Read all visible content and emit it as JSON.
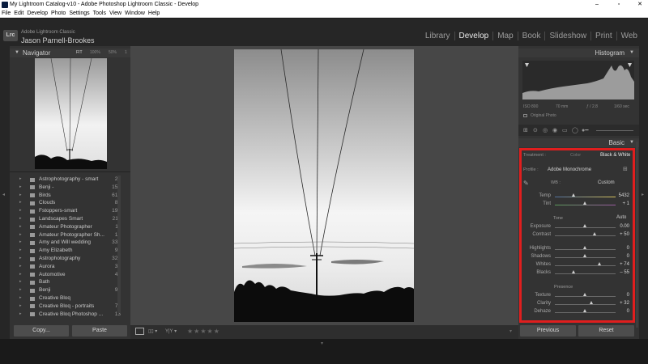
{
  "window": {
    "title": "My Lightroom Catalog-v10 - Adobe Photoshop Lightroom Classic - Develop",
    "minimize": "–",
    "maximize": "▫",
    "close": "✕"
  },
  "menu": [
    "File",
    "Edit",
    "Develop",
    "Photo",
    "Settings",
    "Tools",
    "View",
    "Window",
    "Help"
  ],
  "identity": {
    "badge": "Lrc",
    "product": "Adobe Lightroom Classic",
    "user": "Jason Parnell-Brookes"
  },
  "modules": [
    "Library",
    "Develop",
    "Map",
    "Book",
    "Slideshow",
    "Print",
    "Web"
  ],
  "active_module": "Develop",
  "navigator": {
    "title": "Navigator",
    "zoom_fit": "FIT",
    "zoom_100": "100%",
    "zoom_50": "50%",
    "zoom_1": "1"
  },
  "collections": [
    {
      "name": "Astrophotography - smart",
      "count": "24"
    },
    {
      "name": "Benji -",
      "count": "153"
    },
    {
      "name": "Birds",
      "count": "616"
    },
    {
      "name": "Clouds",
      "count": "87"
    },
    {
      "name": "Fstoppers-smart",
      "count": "194"
    },
    {
      "name": "Landscapes Smart",
      "count": "211"
    },
    {
      "name": "Amateur Photographer",
      "count": "11"
    },
    {
      "name": "Amateur Photographer Sh...",
      "count": "17"
    },
    {
      "name": "Amy and Will wedding",
      "count": "337"
    },
    {
      "name": "Amy Elizabeth",
      "count": "91"
    },
    {
      "name": "Astrophotography",
      "count": "325"
    },
    {
      "name": "Aurora",
      "count": "37"
    },
    {
      "name": "Automotive",
      "count": "41"
    },
    {
      "name": "Bath",
      "count": "3"
    },
    {
      "name": "Benji",
      "count": "93"
    },
    {
      "name": "Creative Bloq",
      "count": "1"
    },
    {
      "name": "Creative Bloq - portraits",
      "count": "79"
    },
    {
      "name": "Creative Bloq Photoshop ...",
      "count": "13"
    }
  ],
  "left_buttons": {
    "copy": "Copy...",
    "paste": "Paste"
  },
  "histogram": {
    "title": "Histogram",
    "iso": "ISO 800",
    "focal": "70 mm",
    "aperture": "ƒ / 2.8",
    "shutter": "1/60 sec",
    "original": "Original Photo"
  },
  "basic": {
    "title": "Basic",
    "treatment_label": "Treatment :",
    "treatment_color": "Color",
    "treatment_bw": "Black & White",
    "profile_label": "Profile :",
    "profile_value": "Adobe Monochrome",
    "wb_label": "WB :",
    "wb_value": "Custom",
    "temp_label": "Temp",
    "temp_value": "5432",
    "tint_label": "Tint",
    "tint_value": "+ 1",
    "tone_label": "Tone",
    "tone_auto": "Auto",
    "exposure_label": "Exposure",
    "exposure_value": "0.00",
    "contrast_label": "Contrast",
    "contrast_value": "+ 50",
    "highlights_label": "Highlights",
    "highlights_value": "0",
    "shadows_label": "Shadows",
    "shadows_value": "0",
    "whites_label": "Whites",
    "whites_value": "+ 74",
    "blacks_label": "Blacks",
    "blacks_value": "– 55",
    "presence_label": "Presence",
    "texture_label": "Texture",
    "texture_value": "0",
    "clarity_label": "Clarity",
    "clarity_value": "+ 32",
    "dehaze_label": "Dehaze",
    "dehaze_value": "0"
  },
  "right_buttons": {
    "previous": "Previous",
    "reset": "Reset"
  },
  "filmstrip": {
    "stars": "★★★★★"
  },
  "highlight_color": "#e01e1e"
}
